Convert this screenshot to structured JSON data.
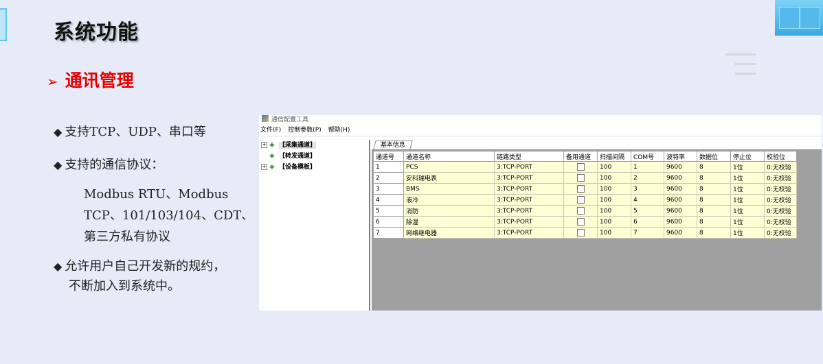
{
  "slide": {
    "title": "系统功能",
    "section": "通讯管理",
    "section_marker": "➢",
    "bullet_marker": "◆",
    "bullet1": "支持TCP、UDP、串口等",
    "bullet2": "支持的通信协议：",
    "protocols": [
      "Modbus RTU、Modbus",
      "TCP、101/103/104、CDT、",
      "第三方私有协议"
    ],
    "bullet3_line1": "允许用户自己开发新的规约，",
    "bullet3_line2": "不断加入到系统中。",
    "accent_color": "#e60000"
  },
  "app": {
    "title": "通信配置工具",
    "menu": [
      "文件(F)",
      "控制参数(P)",
      "帮助(H)"
    ],
    "tree": [
      {
        "label": "【采集通道】",
        "icon": "network-icon"
      },
      {
        "label": "【转发通道】",
        "icon": "network-icon"
      },
      {
        "label": "【设备模板】",
        "icon": "network-icon"
      }
    ],
    "tab": "基本信息",
    "columns": [
      "通道号",
      "通道名称",
      "链路类型",
      "备用通道",
      "扫描间隔",
      "COM号",
      "波特率",
      "数据位",
      "停止位",
      "校验位"
    ],
    "rows": [
      [
        "1",
        "PCS",
        "3:TCP-PORT",
        "",
        "100",
        "1",
        "9600",
        "8",
        "1位",
        "0:无校验"
      ],
      [
        "2",
        "安科瑞电表",
        "3:TCP-PORT",
        "",
        "100",
        "2",
        "9600",
        "8",
        "1位",
        "0:无校验"
      ],
      [
        "3",
        "BMS",
        "3:TCP-PORT",
        "",
        "100",
        "3",
        "9600",
        "8",
        "1位",
        "0:无校验"
      ],
      [
        "4",
        "液冷",
        "3:TCP-PORT",
        "",
        "100",
        "4",
        "9600",
        "8",
        "1位",
        "0:无校验"
      ],
      [
        "5",
        "消防",
        "3:TCP-PORT",
        "",
        "100",
        "5",
        "9600",
        "8",
        "1位",
        "0:无校验"
      ],
      [
        "6",
        "除湿",
        "3:TCP-PORT",
        "",
        "100",
        "6",
        "9600",
        "8",
        "1位",
        "0:无校验"
      ],
      [
        "7",
        "网络继电器",
        "3:TCP-PORT",
        "",
        "100",
        "7",
        "9600",
        "8",
        "1位",
        "0:无校验"
      ]
    ]
  }
}
